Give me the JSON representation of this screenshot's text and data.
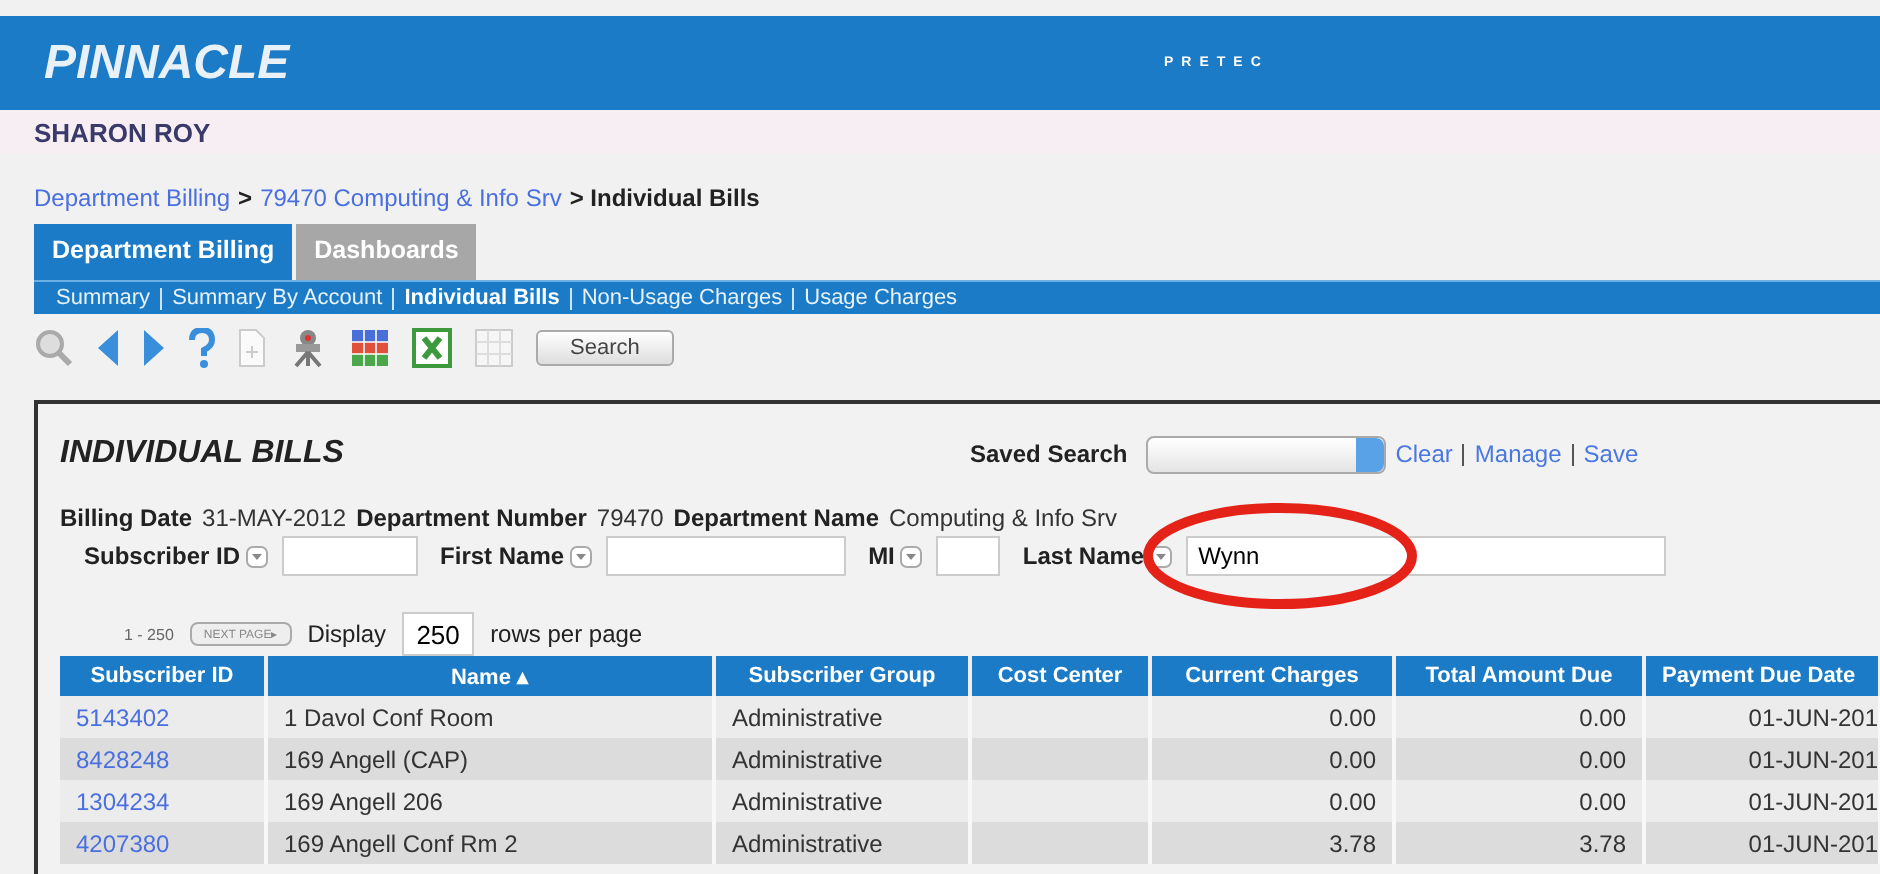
{
  "header": {
    "logo": "PINNACLE",
    "brand": "PRETEC"
  },
  "user": "SHARON ROY",
  "breadcrumb": [
    {
      "label": "Department Billing",
      "kind": "link"
    },
    {
      "label": ">",
      "kind": "text"
    },
    {
      "label": "79470 Computing & Info Srv",
      "kind": "link"
    },
    {
      "label": "> Individual Bills",
      "kind": "text"
    }
  ],
  "tabs": [
    {
      "label": "Department Billing",
      "selected": true
    },
    {
      "label": "Dashboards",
      "selected": false
    }
  ],
  "subnav": [
    {
      "label": "Summary",
      "selected": false
    },
    {
      "label": "Summary By Account",
      "selected": false
    },
    {
      "label": "Individual Bills",
      "selected": true
    },
    {
      "label": "Non-Usage Charges",
      "selected": false
    },
    {
      "label": "Usage Charges",
      "selected": false
    }
  ],
  "toolbar": {
    "search_button": "Search"
  },
  "panel": {
    "title": "INDIVIDUAL BILLS",
    "saved_search_label": "Saved Search",
    "links": [
      "Clear",
      "Manage",
      "Save"
    ],
    "info": [
      {
        "label": "Billing Date",
        "value": "31-MAY-2012"
      },
      {
        "label": "Department Number",
        "value": "79470"
      },
      {
        "label": "Department Name",
        "value": "Computing & Info Srv"
      }
    ],
    "filters": [
      {
        "label": "Subscriber ID"
      },
      {
        "label": "First Name"
      },
      {
        "label": "MI"
      },
      {
        "label": "Last Name",
        "value": "Wynn"
      }
    ],
    "range": "1 - 250",
    "next_button": "NEXT PAGE▸",
    "display_label": "Display",
    "rows_per_page": "250",
    "rows_label": "rows per page"
  },
  "table": {
    "columns": [
      "Subscriber ID",
      "Name ▴",
      "Subscriber Group",
      "Cost Center",
      "Current Charges",
      "Total Amount Due",
      "Payment Due Date"
    ],
    "rows": [
      [
        "5143402",
        "1 Davol Conf Room",
        "Administrative",
        "",
        "0.00",
        "0.00",
        "01-JUN-201"
      ],
      [
        "8428248",
        "169 Angell (CAP)",
        "Administrative",
        "",
        "0.00",
        "0.00",
        "01-JUN-201"
      ],
      [
        "1304234",
        "169 Angell 206",
        "Administrative",
        "",
        "0.00",
        "0.00",
        "01-JUN-201"
      ],
      [
        "4207380",
        "169 Angell Conf Rm 2",
        "Administrative",
        "",
        "3.78",
        "3.78",
        "01-JUN-201"
      ]
    ]
  }
}
